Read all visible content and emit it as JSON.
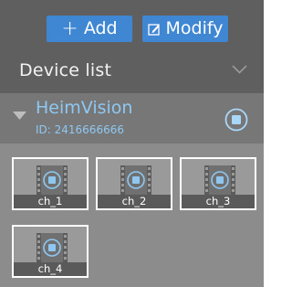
{
  "toolbar": {
    "add_label": "Add",
    "modify_label": "Modify"
  },
  "device_list": {
    "title": "Device list"
  },
  "device": {
    "name": "HeimVision",
    "id_text": "ID: 2416666666"
  },
  "channels": [
    {
      "label": "ch_1"
    },
    {
      "label": "ch_2"
    },
    {
      "label": "ch_3"
    },
    {
      "label": "ch_4"
    }
  ],
  "colors": {
    "accent": "#3f86d3",
    "device_text": "#8ec8f2"
  }
}
